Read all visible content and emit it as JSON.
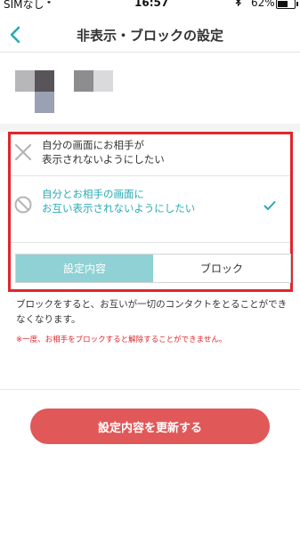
{
  "status_bar": {
    "carrier": "SIMなし",
    "time": "16:57",
    "battery_pct": "62%",
    "battery_level": 0.62,
    "icons": [
      "wifi-icon",
      "bluetooth-icon",
      "battery-icon"
    ]
  },
  "nav": {
    "title": "非表示・ブロックの設定",
    "back_icon": "chevron-left-icon",
    "accent": "#29aab5"
  },
  "profile": {
    "avatar": "pixelated-avatar"
  },
  "options": [
    {
      "icon": "close-x-icon",
      "label": "自分の画面にお相手が\n表示されないようにしたい",
      "selected": false
    },
    {
      "icon": "prohibited-icon",
      "label": "自分とお相手の画面に\nお互い表示されないようにしたい",
      "selected": true,
      "check_icon": "checkmark-icon"
    }
  ],
  "segmented": {
    "settings_label": "設定内容",
    "block_label": "ブロック",
    "active": "settings"
  },
  "note": "ブロックをすると、お互いが一切のコンタクトをとることができなくなります。",
  "warning": "※一度、お相手をブロックすると解除することができません。",
  "update_button": "設定内容を更新する",
  "colors": {
    "highlight_border": "#e0252b",
    "teal": "#29aab5",
    "segment_active": "#8fd1d4",
    "button": "#e05858",
    "warning_text": "#e0252b"
  }
}
